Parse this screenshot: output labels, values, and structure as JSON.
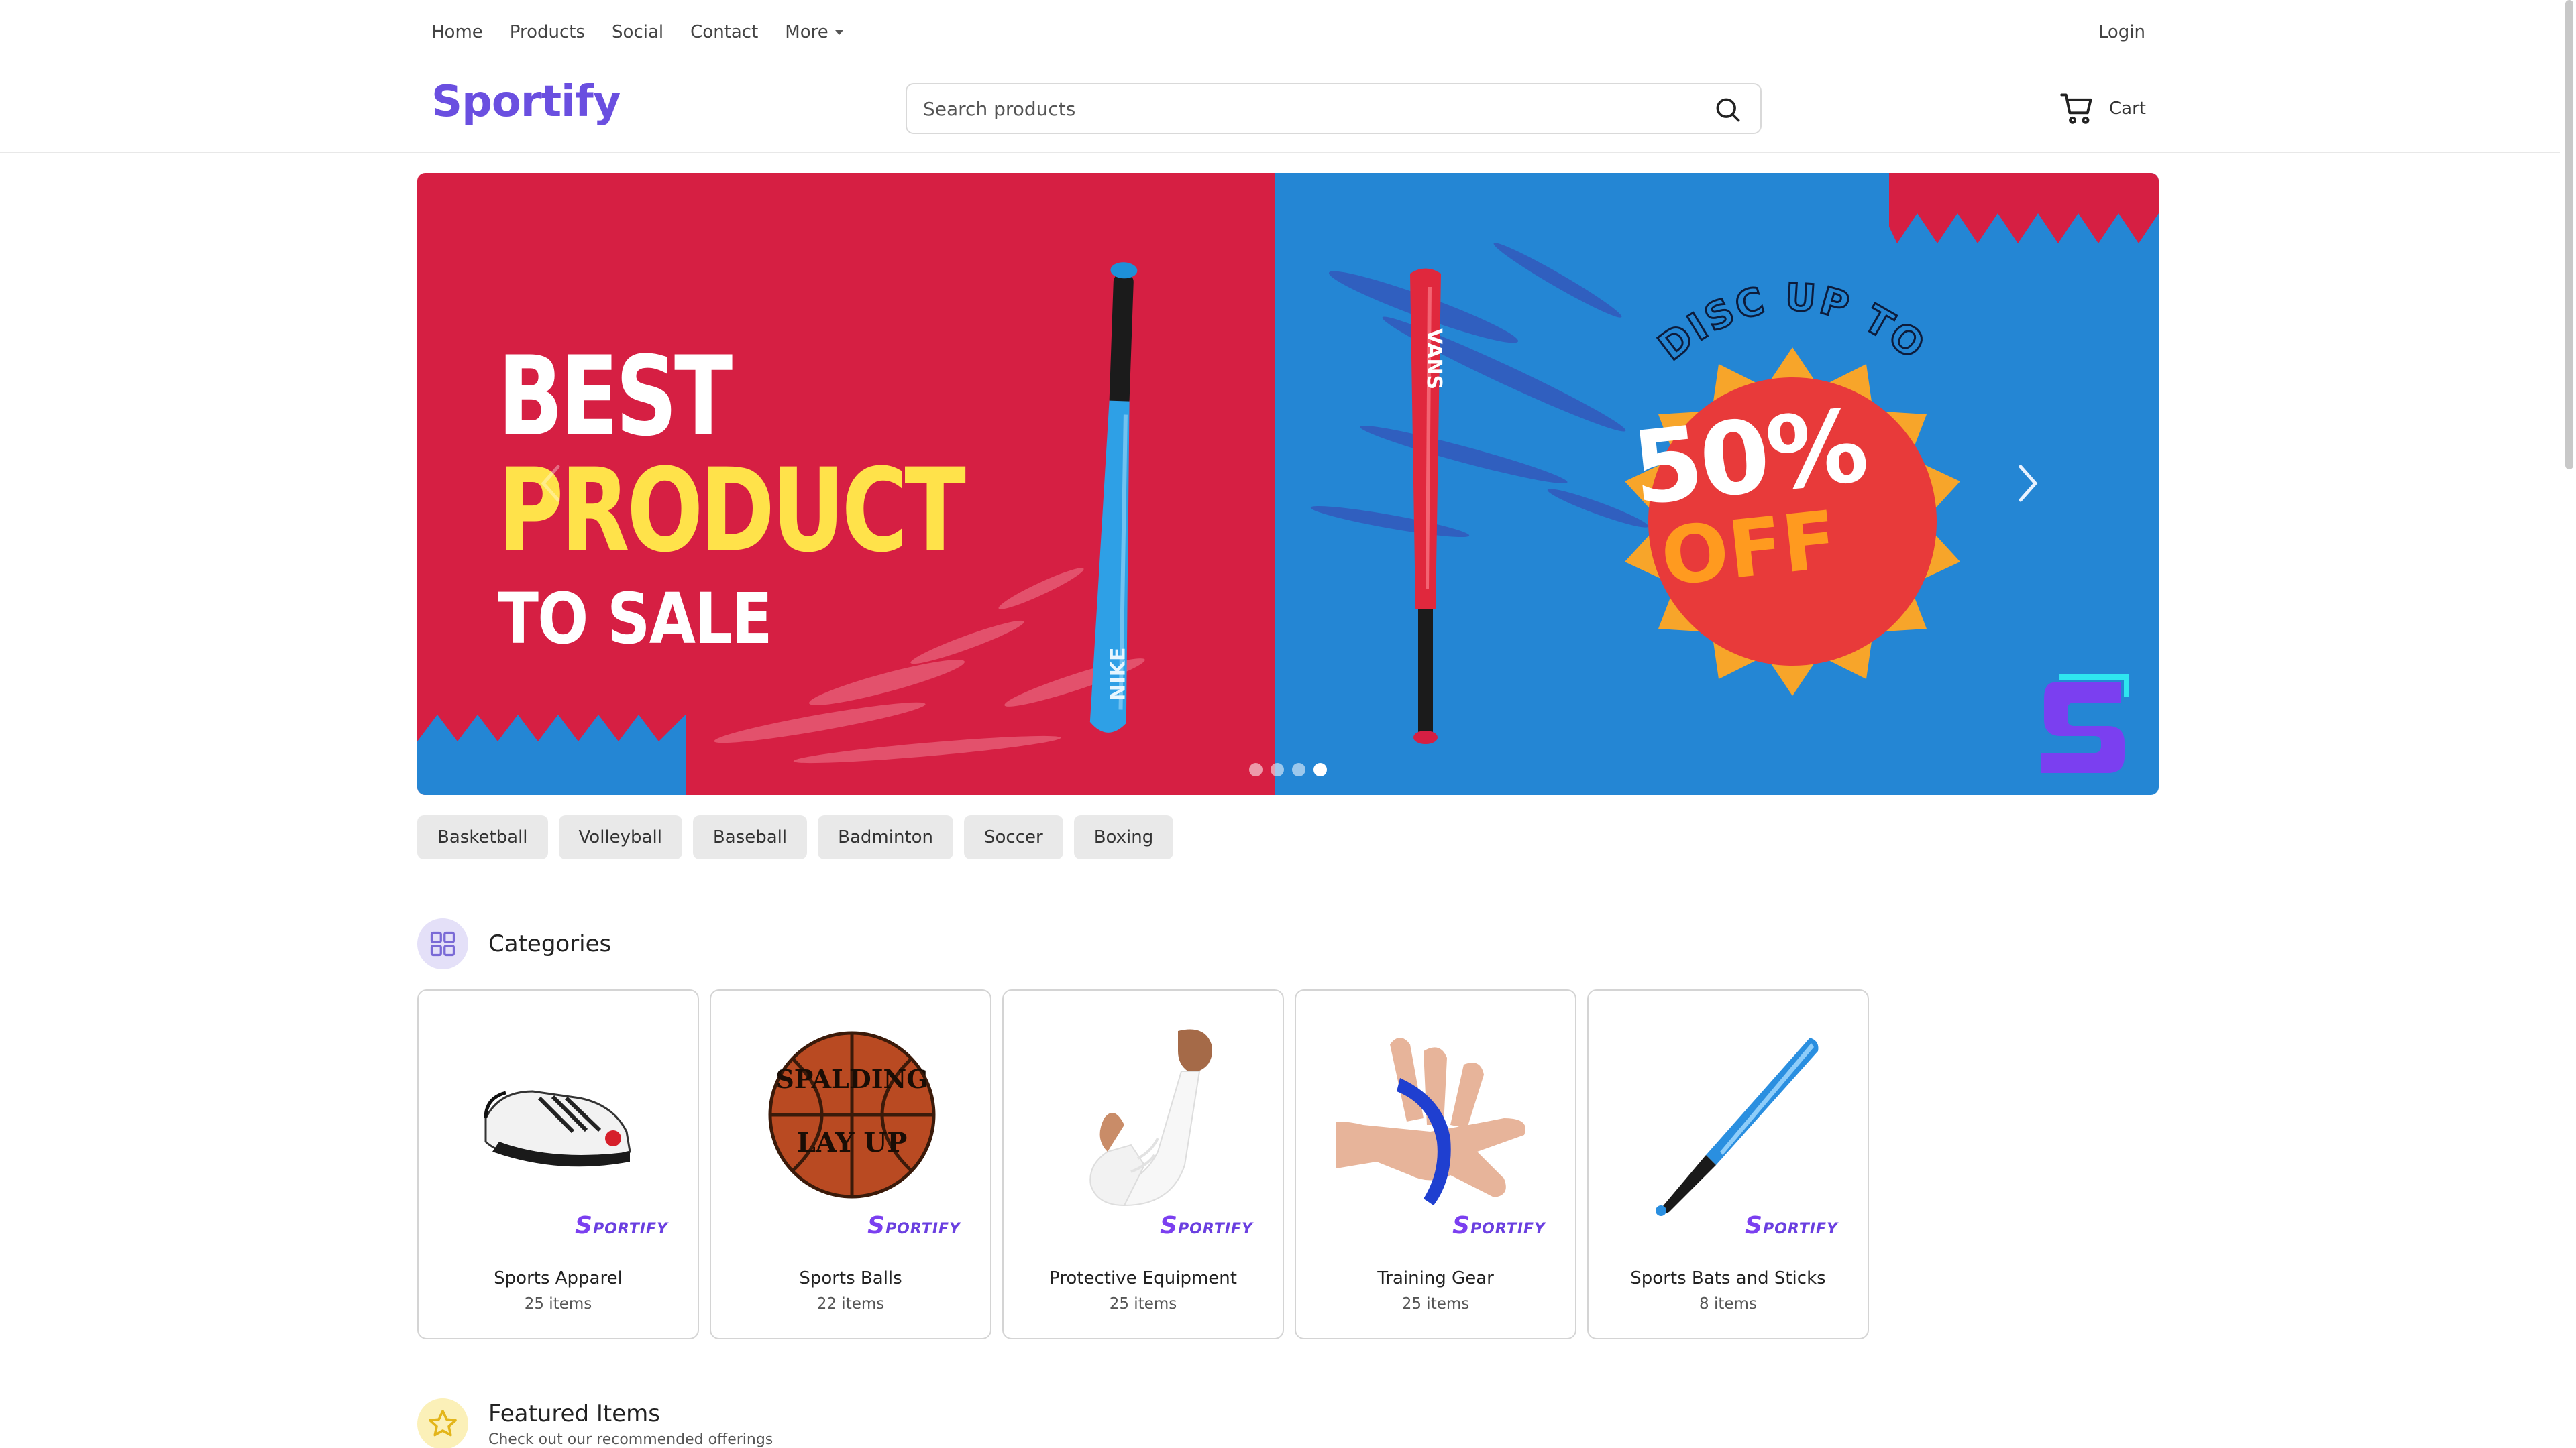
{
  "topnav": {
    "links": [
      "Home",
      "Products",
      "Social",
      "Contact",
      "More"
    ],
    "login": "Login"
  },
  "header": {
    "logo": "Sportify",
    "search_placeholder": "Search products",
    "cart_label": "Cart"
  },
  "hero": {
    "line1": "BEST",
    "line2": "PRODUCT",
    "line3": "TO SALE",
    "badge_top": "DISC UP TO",
    "badge_pct": "50%",
    "badge_off": "OFF",
    "bat_left_brand": "NIKE",
    "bat_right_brand": "VANS",
    "slide_count": 4,
    "active_slide": 4,
    "colors": {
      "red": "#d61f43",
      "blue": "#2486d4",
      "yellow": "#ffe24a",
      "badge_red": "#e83a3a",
      "badge_orange": "#f7a52a"
    }
  },
  "chips": [
    "Basketball",
    "Volleyball",
    "Baseball",
    "Badminton",
    "Soccer",
    "Boxing"
  ],
  "categories_section": {
    "title": "Categories",
    "items": [
      {
        "name": "Sports Apparel",
        "count": "25 items",
        "icon": "cycling-shoe"
      },
      {
        "name": "Sports Balls",
        "count": "22 items",
        "icon": "basketball"
      },
      {
        "name": "Protective Equipment",
        "count": "25 items",
        "icon": "arm-sleeve"
      },
      {
        "name": "Training Gear",
        "count": "25 items",
        "icon": "finger-trainer"
      },
      {
        "name": "Sports Bats and Sticks",
        "count": "8 items",
        "icon": "baseball-bat"
      }
    ],
    "brand_mark": "PORTIFY",
    "brand_mark_initial": "S",
    "ball_text_top": "SPALDING",
    "ball_text_bottom": "LAY UP"
  },
  "featured_section": {
    "title": "Featured Items",
    "subtitle": "Check out our recommended offerings"
  },
  "accent_color": "#6a4fe0"
}
